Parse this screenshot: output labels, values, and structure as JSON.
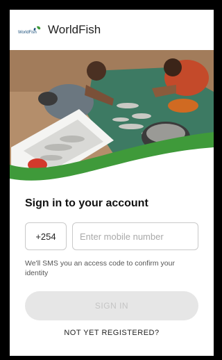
{
  "app": {
    "title": "WorldFish",
    "logo_text": "WorldFish"
  },
  "login": {
    "heading": "Sign in to your account",
    "country_code": "+254",
    "phone_placeholder": "Enter mobile number",
    "hint": "We'll SMS you an access code to confirm your identity",
    "signin_label": "SIGN IN",
    "register_label": "NOT YET REGISTERED?"
  },
  "colors": {
    "brand_green": "#3f9a3a",
    "button_disabled_bg": "#e6e6e6",
    "button_disabled_text": "#c4c4c4"
  },
  "icons": {
    "logo": "worldfish-logo-icon"
  }
}
